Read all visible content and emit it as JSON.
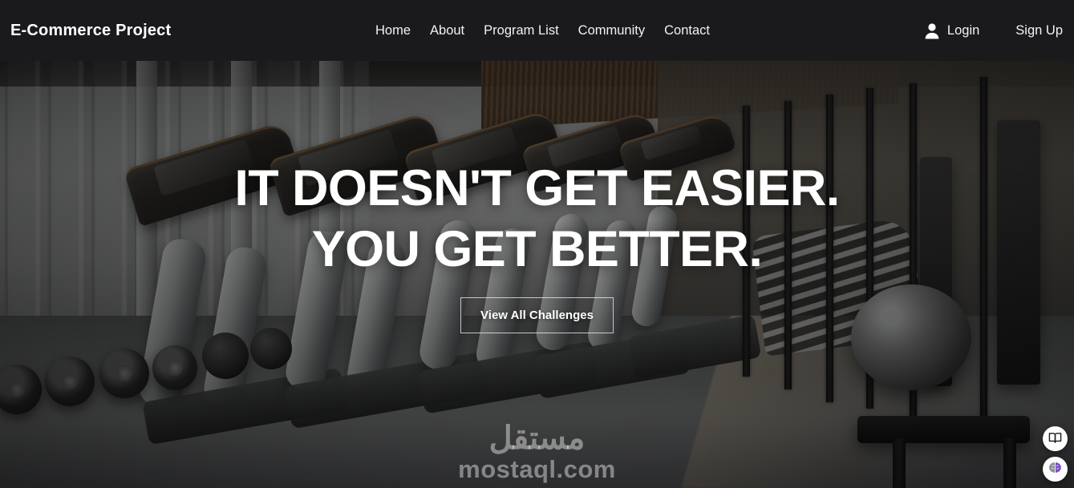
{
  "navbar": {
    "brand": "E-Commerce Project",
    "links": [
      {
        "label": "Home"
      },
      {
        "label": "About"
      },
      {
        "label": "Program List"
      },
      {
        "label": "Community"
      },
      {
        "label": "Contact"
      }
    ],
    "auth": {
      "user_icon": "user-icon",
      "login_label": "Login",
      "signup_label": "Sign Up"
    },
    "background_color": "#1a1a1c",
    "text_color": "#ffffff"
  },
  "hero": {
    "headline_line1": "IT DOESN'T GET EASIER.",
    "headline_line2": "YOU GET BETTER.",
    "cta_label": "View All Challenges",
    "headline_color": "#ffffff",
    "image_description": "Gym interior with a row of treadmills along a window wall and weight machines on the right"
  },
  "watermark": {
    "arabic": "مستقل",
    "latin": "mostaql.com",
    "color": "rgba(255,255,255,0.42)"
  },
  "widgets": [
    {
      "name": "book-icon",
      "icon": "open-book",
      "color": "#1c1c1c"
    },
    {
      "name": "brain-icon",
      "icon": "brain",
      "color": "#7b52c9"
    }
  ]
}
